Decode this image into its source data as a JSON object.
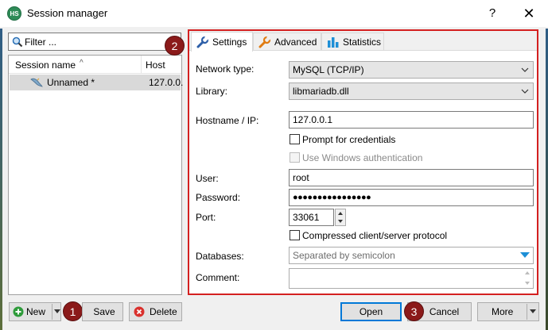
{
  "window": {
    "title": "Session manager",
    "app_icon_text": "HS",
    "help_glyph": "?",
    "close_glyph": "✕"
  },
  "filter": {
    "placeholder": "Filter ..."
  },
  "session_list": {
    "columns": [
      "Session name",
      "Host"
    ],
    "sort_glyph": "^",
    "rows": [
      {
        "name": "Unnamed *",
        "host": "127.0.0."
      }
    ]
  },
  "badges": [
    "1",
    "2",
    "3"
  ],
  "tabs": [
    {
      "label": "Settings",
      "icon": "wrench-icon",
      "active": true
    },
    {
      "label": "Advanced",
      "icon": "wrench-orange-icon",
      "active": false
    },
    {
      "label": "Statistics",
      "icon": "bar-chart-icon",
      "active": false
    }
  ],
  "settings": {
    "network_type_label": "Network type:",
    "network_type_value": "MySQL (TCP/IP)",
    "library_label": "Library:",
    "library_value": "libmariadb.dll",
    "hostname_label": "Hostname / IP:",
    "hostname_value": "127.0.0.1",
    "prompt_credentials_label": "Prompt for credentials",
    "windows_auth_label": "Use Windows authentication",
    "user_label": "User:",
    "user_value": "root",
    "password_label": "Password:",
    "password_value": "●●●●●●●●●●●●●●●●",
    "port_label": "Port:",
    "port_value": "33061",
    "compressed_label": "Compressed client/server protocol",
    "databases_label": "Databases:",
    "databases_placeholder": "Separated by semicolon",
    "comment_label": "Comment:"
  },
  "buttons": {
    "new": "New",
    "save": "Save",
    "delete": "Delete",
    "open": "Open",
    "cancel": "Cancel",
    "more": "More"
  },
  "colors": {
    "accent": "#0078d7",
    "badge": "#8b1a1a",
    "frame": "#d42020",
    "selected_row": "#d9d9d9"
  }
}
